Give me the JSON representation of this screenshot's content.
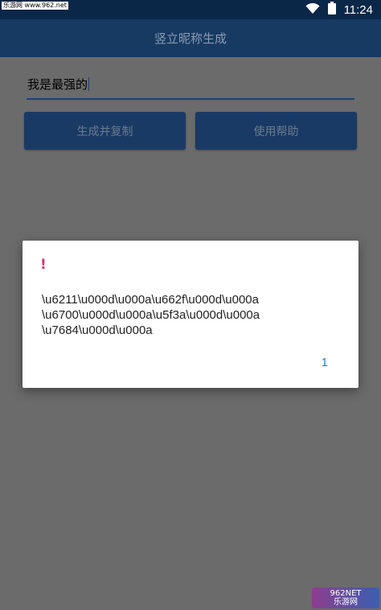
{
  "status_bar": {
    "watermark": "乐游网 www.962.net",
    "time": "11:24",
    "icons": [
      "wifi-icon",
      "battery-icon"
    ]
  },
  "app_bar": {
    "title": "竖立昵称生成"
  },
  "input": {
    "value": "我是最强的"
  },
  "buttons": {
    "generate_label": "生成并复制",
    "help_label": "使用帮助"
  },
  "dialog": {
    "title": "!",
    "message": "\\u6211\\u000d\\u000a\\u662f\\u000d\\u000a\n\\u6700\\u000d\\u000a\\u5f3a\\u000d\\u000a\n\\u7684\\u000d\\u000a",
    "button_label": "1"
  },
  "footer_watermark": {
    "line1": "962NET",
    "line2": "乐游网"
  },
  "colors": {
    "status_bar": "#0b2748",
    "app_bar": "#173a63",
    "overlay": "#6b6b6b",
    "accent": "#1d3f78",
    "dialog_title": "#e0306f",
    "dialog_button": "#2a7fd4"
  }
}
